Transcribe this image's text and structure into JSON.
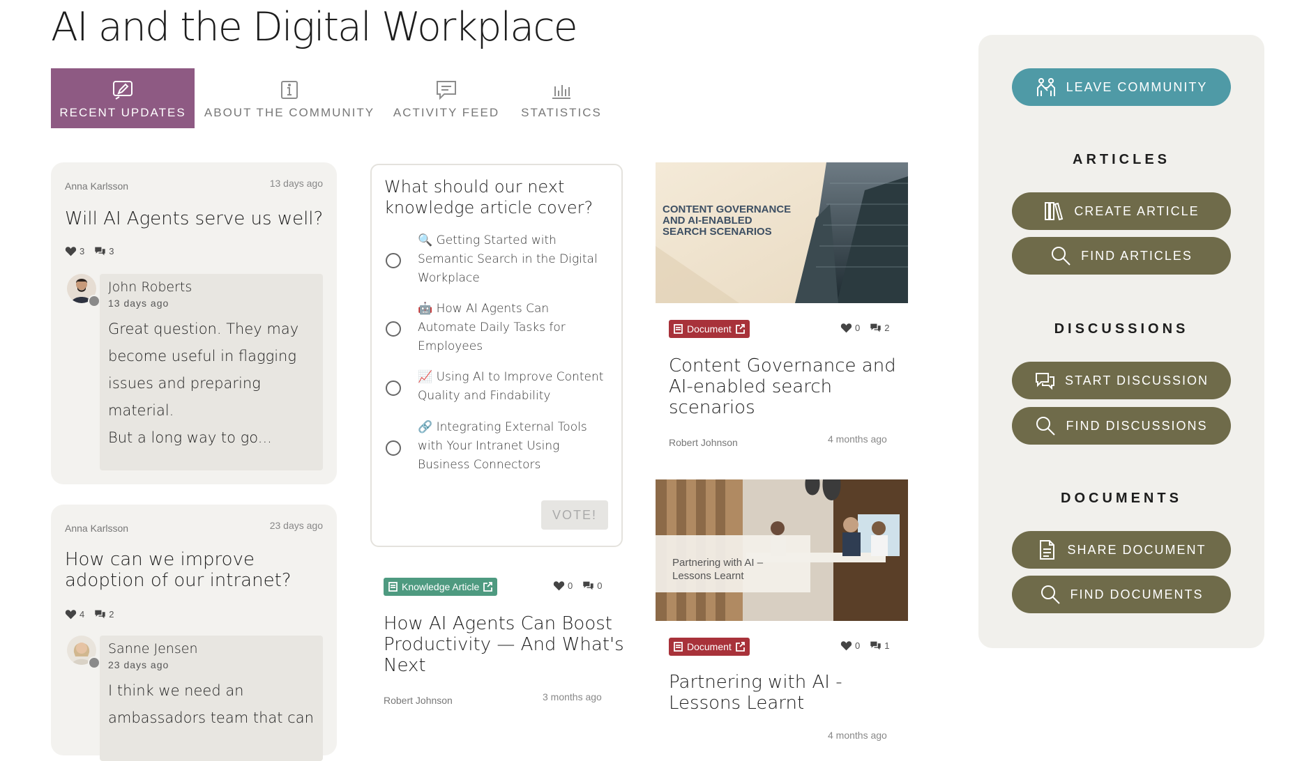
{
  "page": {
    "title": "AI and the Digital Workplace"
  },
  "tabs": [
    {
      "label": "RECENT UPDATES",
      "icon": "edit-icon",
      "active": true
    },
    {
      "label": "ABOUT THE COMMUNITY",
      "icon": "info-icon",
      "active": false
    },
    {
      "label": "ACTIVITY FEED",
      "icon": "chat-icon",
      "active": false
    },
    {
      "label": "STATISTICS",
      "icon": "bar-chart-icon",
      "active": false
    }
  ],
  "colors": {
    "accent_purple": "#8e5a83",
    "teal": "#4f9aa6",
    "olive": "#6f6b4a",
    "doc_red": "#a8323a",
    "ka_green": "#4e9a80"
  },
  "discussions": [
    {
      "author": "Anna Karlsson",
      "time": "13 days ago",
      "title": "Will AI Agents serve us well?",
      "likes": "3",
      "comments": "3",
      "reply": {
        "name": "John Roberts",
        "time": "13 days ago",
        "lines": [
          "Great question. They may",
          "become useful in flagging",
          "issues and preparing material.",
          "But a long way to go..."
        ]
      }
    },
    {
      "author": "Anna Karlsson",
      "time": "23 days ago",
      "title_lines": [
        "How can we improve",
        "adoption of our intranet?"
      ],
      "likes": "4",
      "comments": "2",
      "reply": {
        "name": "Sanne Jensen",
        "time": "23 days ago",
        "lines": [
          "I think we need an",
          "ambassadors team that can"
        ]
      }
    }
  ],
  "poll": {
    "question_lines": [
      "What should our next",
      "knowledge article cover?"
    ],
    "options": [
      {
        "emoji": "🔍",
        "lines": [
          "Getting Started with",
          "Semantic Search in the Digital",
          "Workplace"
        ]
      },
      {
        "emoji": "🤖",
        "lines": [
          "How AI Agents Can",
          "Automate Daily Tasks for",
          "Employees"
        ]
      },
      {
        "emoji": "📈",
        "lines": [
          "Using AI to Improve Content",
          "Quality and Findability"
        ]
      },
      {
        "emoji": "🔗",
        "lines": [
          "Integrating External Tools",
          "with Your Intranet Using",
          "Business Connectors"
        ]
      }
    ],
    "vote_label": "VOTE!"
  },
  "knowledge_article": {
    "badge": "Knowledge Article",
    "likes": "0",
    "comments": "0",
    "title_lines": [
      "How AI Agents Can Boost",
      "Productivity — And What's",
      "Next"
    ],
    "author": "Robert Johnson",
    "time": "3 months ago"
  },
  "documents": [
    {
      "image_text_lines": [
        "CONTENT GOVERNANCE",
        "AND AI-ENABLED",
        "SEARCH SCENARIOS"
      ],
      "badge": "Document",
      "likes": "0",
      "comments": "2",
      "title_lines": [
        "Content Governance and",
        "AI-enabled search",
        "scenarios"
      ],
      "author": "Robert Johnson",
      "time": "4 months ago"
    },
    {
      "image_text_lines": [
        "Partnering with AI –",
        "Lessons Learnt"
      ],
      "badge": "Document",
      "likes": "0",
      "comments": "1",
      "title_lines": [
        "Partnering with AI -",
        "Lessons Learnt"
      ],
      "time": "4 months ago"
    }
  ],
  "sidebar": {
    "leave_label": "LEAVE COMMUNITY",
    "articles_heading": "ARTICLES",
    "create_article_label": "CREATE ARTICLE",
    "find_articles_label": "FIND ARTICLES",
    "discussions_heading": "DISCUSSIONS",
    "start_discussion_label": "START DISCUSSION",
    "find_discussions_label": "FIND DISCUSSIONS",
    "documents_heading": "DOCUMENTS",
    "share_document_label": "SHARE DOCUMENT",
    "find_documents_label": "FIND DOCUMENTS"
  }
}
